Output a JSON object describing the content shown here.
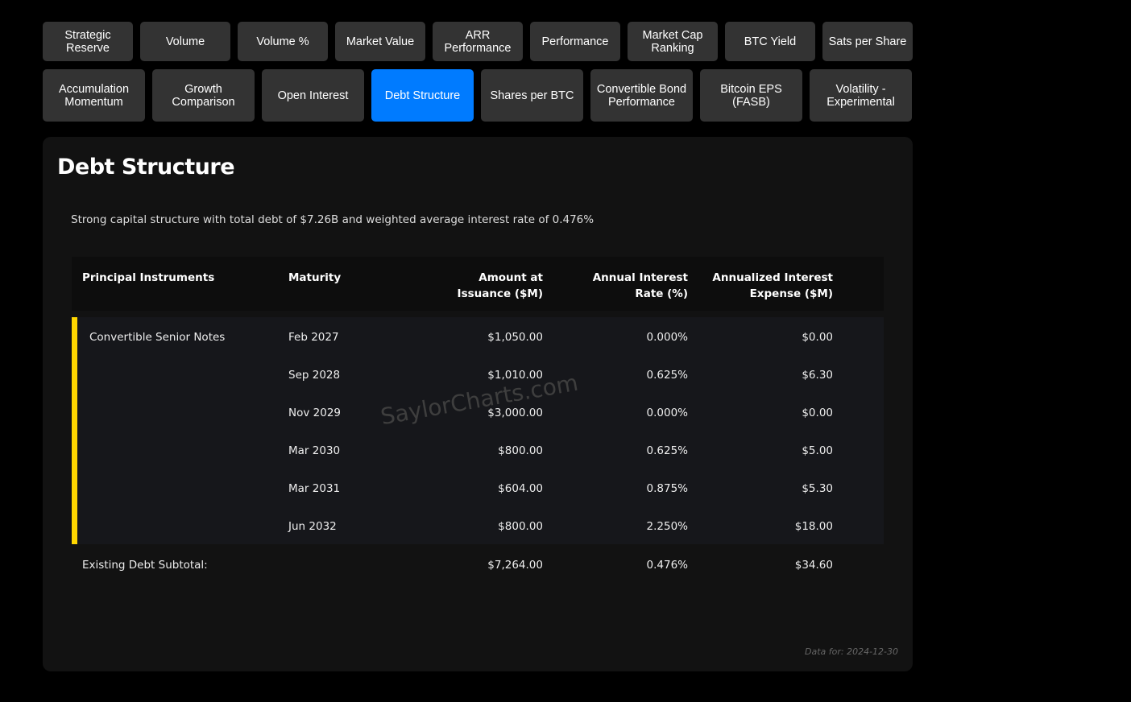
{
  "tabs_row1": [
    "Strategic Reserve",
    "Volume",
    "Volume %",
    "Market Value",
    "ARR Performance",
    "Performance",
    "Market Cap Ranking",
    "BTC Yield",
    "Sats per Share"
  ],
  "tabs_row2": [
    "Accumulation Momentum",
    "Growth Comparison",
    "Open Interest",
    "Debt Structure",
    "Shares per BTC",
    "Convertible Bond Performance",
    "Bitcoin EPS (FASB)",
    "Volatility - Experimental"
  ],
  "active_tab": "Debt Structure",
  "accent_color": "#007bff",
  "highlight_color": "#ffd700",
  "card": {
    "title": "Debt Structure",
    "subtitle": "Strong capital structure with total debt of $7.26B and weighted average interest rate of 0.476%",
    "watermark": "SaylorCharts.com",
    "footer": "Data for: 2024-12-30"
  },
  "table": {
    "headers": [
      "Principal Instruments",
      "Maturity",
      "Amount at Issuance ($M)",
      "Annual Interest Rate (%)",
      "Annualized Interest Expense ($M)"
    ],
    "group_label": "Convertible Senior Notes",
    "rows": [
      {
        "maturity": "Feb 2027",
        "amount": "$1,050.00",
        "rate": "0.000%",
        "expense": "$0.00"
      },
      {
        "maturity": "Sep 2028",
        "amount": "$1,010.00",
        "rate": "0.625%",
        "expense": "$6.30"
      },
      {
        "maturity": "Nov 2029",
        "amount": "$3,000.00",
        "rate": "0.000%",
        "expense": "$0.00"
      },
      {
        "maturity": "Mar 2030",
        "amount": "$800.00",
        "rate": "0.625%",
        "expense": "$5.00"
      },
      {
        "maturity": "Mar 2031",
        "amount": "$604.00",
        "rate": "0.875%",
        "expense": "$5.30"
      },
      {
        "maturity": "Jun 2032",
        "amount": "$800.00",
        "rate": "2.250%",
        "expense": "$18.00"
      }
    ],
    "subtotal": {
      "label": "Existing Debt Subtotal:",
      "amount": "$7,264.00",
      "rate": "0.476%",
      "expense": "$34.60"
    }
  }
}
